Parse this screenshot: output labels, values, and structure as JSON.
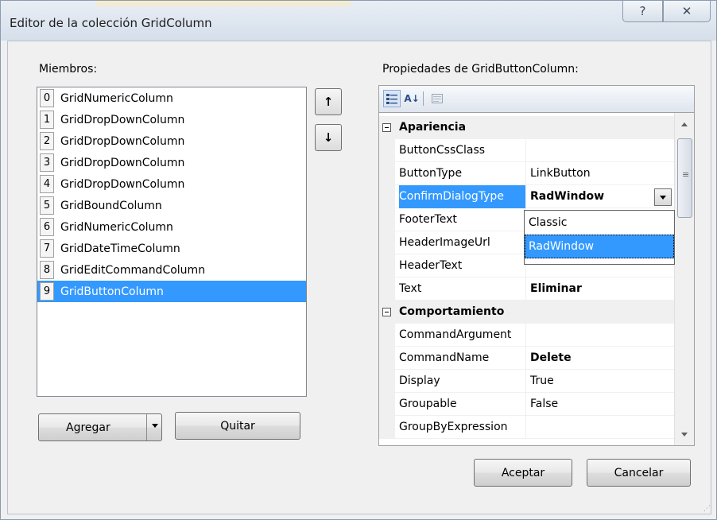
{
  "window": {
    "title": "Editor de la colección GridColumn",
    "help_glyph": "?",
    "close_glyph": "✕"
  },
  "members": {
    "label": "Miembros:",
    "items": [
      {
        "index": "0",
        "name": "GridNumericColumn"
      },
      {
        "index": "1",
        "name": "GridDropDownColumn"
      },
      {
        "index": "2",
        "name": "GridDropDownColumn"
      },
      {
        "index": "3",
        "name": "GridDropDownColumn"
      },
      {
        "index": "4",
        "name": "GridDropDownColumn"
      },
      {
        "index": "5",
        "name": "GridBoundColumn"
      },
      {
        "index": "6",
        "name": "GridNumericColumn"
      },
      {
        "index": "7",
        "name": "GridDateTimeColumn"
      },
      {
        "index": "8",
        "name": "GridEditCommandColumn"
      },
      {
        "index": "9",
        "name": "GridButtonColumn"
      }
    ],
    "selected_index": 9,
    "move_up_glyph": "↑",
    "move_down_glyph": "↓"
  },
  "buttons": {
    "add": "Agregar",
    "remove": "Quitar",
    "ok": "Aceptar",
    "cancel": "Cancelar"
  },
  "properties": {
    "label": "Propiedades de GridButtonColumn:",
    "toolbar_icons": [
      "categorized-icon",
      "alphabetical-icon",
      "property-pages-icon"
    ],
    "alphabetical_glyph": "A↓",
    "categories": [
      {
        "name": "Apariencia",
        "rows": [
          {
            "name": "ButtonCssClass",
            "value": "",
            "bold": false
          },
          {
            "name": "ButtonType",
            "value": "LinkButton",
            "bold": false
          },
          {
            "name": "ConfirmDialogType",
            "value": "RadWindow",
            "bold": true,
            "selected": true
          },
          {
            "name": "FooterText",
            "value": "",
            "bold": false
          },
          {
            "name": "HeaderImageUrl",
            "value": "",
            "bold": false
          },
          {
            "name": "HeaderText",
            "value": "",
            "bold": false
          },
          {
            "name": "Text",
            "value": "Eliminar",
            "bold": true
          }
        ]
      },
      {
        "name": "Comportamiento",
        "rows": [
          {
            "name": "CommandArgument",
            "value": "",
            "bold": false
          },
          {
            "name": "CommandName",
            "value": "Delete",
            "bold": true
          },
          {
            "name": "Display",
            "value": "True",
            "bold": false
          },
          {
            "name": "Groupable",
            "value": "False",
            "bold": false
          },
          {
            "name": "GroupByExpression",
            "value": "",
            "bold": false
          }
        ]
      }
    ],
    "dropdown_options": [
      "Classic",
      "RadWindow"
    ],
    "dropdown_selected": "RadWindow"
  },
  "colors": {
    "selection": "#3399ff",
    "dialog_bg": "#f0f0f0"
  }
}
